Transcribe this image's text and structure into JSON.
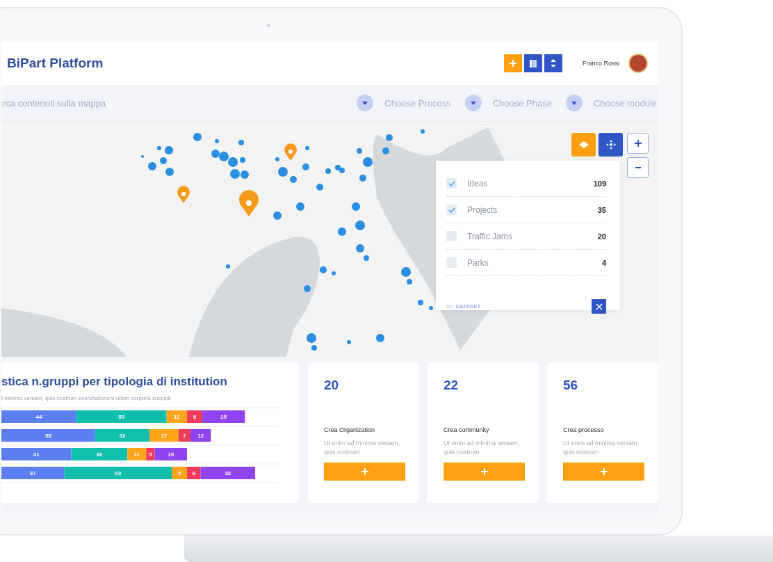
{
  "header": {
    "title": "BiPart Platform",
    "user_name": "Franco Rossi"
  },
  "filters": {
    "search_placeholder": "rca contenuti sulla mappa",
    "dropdowns": [
      "Choose Process",
      "Choose Phase",
      "Choose module"
    ]
  },
  "legend": {
    "items": [
      {
        "label": "Ideas",
        "count": "109",
        "checked": true
      },
      {
        "label": "Projects",
        "count": "35",
        "checked": true
      },
      {
        "label": "Traffic Jams",
        "count": "20",
        "checked": false
      },
      {
        "label": "Parks",
        "count": "4",
        "checked": false
      }
    ],
    "by_label": "BY",
    "dataset_link": "DATASET"
  },
  "chart_card": {
    "title": "stica n.gruppi per tipologia di institution",
    "subtitle": "t minima veniam, quis nostrum exercitationem ullam corporis suscipit",
    "chart_data": {
      "type": "bar",
      "orientation": "horizontal",
      "stacked": true,
      "data_labels": true,
      "series": [
        {
          "color": "#5b7ff0",
          "values": [
            44,
            55,
            41,
            37
          ]
        },
        {
          "color": "#12bfae",
          "values": [
            53,
            32,
            33,
            63
          ]
        },
        {
          "color": "#ffa41b",
          "values": [
            12,
            17,
            11,
            9
          ]
        },
        {
          "color": "#f03c5a",
          "values": [
            9,
            7,
            5,
            8
          ]
        },
        {
          "color": "#8f44f0",
          "values": [
            25,
            12,
            19,
            32
          ]
        }
      ]
    }
  },
  "stat_cards": [
    {
      "value": "20",
      "title": "Crea Organization",
      "text": "Ut enim ad minima veniam, quis nostrum"
    },
    {
      "value": "22",
      "title": "Crea community",
      "text": "Ut enim ad minima veniam, quis nostrum"
    },
    {
      "value": "56",
      "title": "Crea processo",
      "text": "Ut enim ad minima veniam, quis nostrum"
    }
  ]
}
